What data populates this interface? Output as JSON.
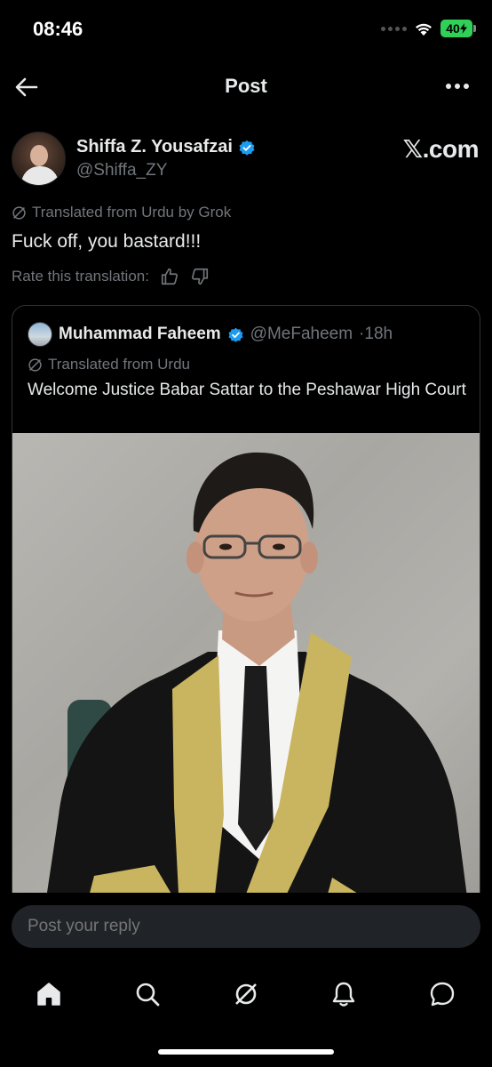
{
  "status_bar": {
    "time": "08:46",
    "battery": "40"
  },
  "nav": {
    "title": "Post"
  },
  "post": {
    "author_name": "Shiffa Z. Yousafzai",
    "author_handle": "@Shiffa_ZY",
    "source_mark": "𝕏.com",
    "translated_label": "Translated from Urdu by Grok",
    "text": "Fuck off, you bastard!!!",
    "rate_label": "Rate this translation:"
  },
  "quote": {
    "author_name": "Muhammad Faheem",
    "author_handle": "@MeFaheem",
    "time": "·18h",
    "translated_label": "Translated from Urdu",
    "text": "Welcome Justice Babar Sattar to the Peshawar High Court"
  },
  "reply": {
    "placeholder": "Post your reply"
  },
  "tabs": [
    {
      "icon": "home-icon"
    },
    {
      "icon": "search-icon"
    },
    {
      "icon": "grok-icon"
    },
    {
      "icon": "bell-icon"
    },
    {
      "icon": "messages-icon"
    }
  ],
  "colors": {
    "accent": "#1d9bf0",
    "text": "#e7e9ea",
    "muted": "#71767b",
    "battery": "#30d158"
  }
}
